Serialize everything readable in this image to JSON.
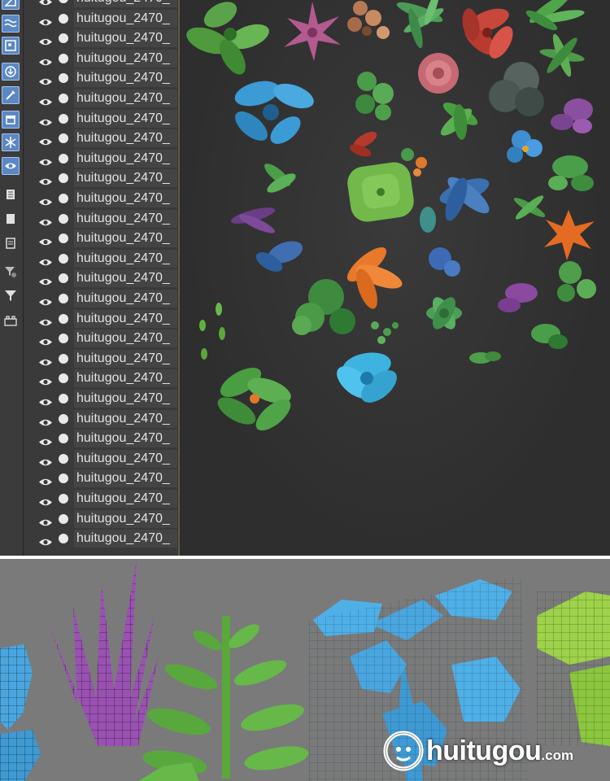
{
  "outliner": {
    "item_label": "huitugou_2470_",
    "row_count": 28
  },
  "toolbar": {
    "tools": [
      {
        "icon": "ruler-icon",
        "active": true
      },
      {
        "icon": "waves-icon",
        "active": true
      },
      {
        "icon": "image-icon",
        "active": true
      },
      {
        "icon": "download-icon",
        "active": true
      },
      {
        "icon": "brush-icon",
        "active": true
      },
      {
        "icon": "archive-icon",
        "active": true
      },
      {
        "icon": "snowflake-icon",
        "active": true
      },
      {
        "icon": "eye-icon",
        "active": true
      },
      {
        "icon": "document-icon",
        "active": false
      },
      {
        "icon": "square-icon",
        "active": false
      },
      {
        "icon": "list-document-icon",
        "active": false
      },
      {
        "icon": "filter-gear-icon",
        "active": false
      },
      {
        "icon": "filter-icon",
        "active": false
      },
      {
        "icon": "layers-icon",
        "active": false
      }
    ]
  },
  "colors": {
    "panel_bg": "#3a3a3a",
    "viewport_bg": "#2f2f2f",
    "active_tool": "#5b87c4",
    "wireframe_bg": "#7a7a7a"
  },
  "watermark": {
    "name": "huitugou",
    "suffix": ".com"
  }
}
